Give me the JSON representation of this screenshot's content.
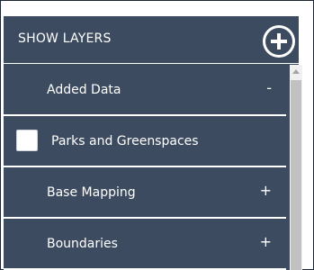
{
  "header": {
    "title": "SHOW LAYERS",
    "add_icon": "plus-circle-icon"
  },
  "layers": [
    {
      "kind": "group",
      "label": "Added Data",
      "toggle": "-",
      "expanded": true
    },
    {
      "kind": "layer",
      "label": "Parks and Greenspaces",
      "checked": false
    },
    {
      "kind": "group",
      "label": "Base Mapping",
      "toggle": "+",
      "expanded": false
    },
    {
      "kind": "group",
      "label": "Boundaries",
      "toggle": "+",
      "expanded": false
    }
  ],
  "colors": {
    "panel_background": "#3c4b5f",
    "text": "#ffffff",
    "divider": "#ffffff",
    "scrollbar_track": "#f0f0f0",
    "scrollbar_thumb": "#c1c1c1"
  }
}
